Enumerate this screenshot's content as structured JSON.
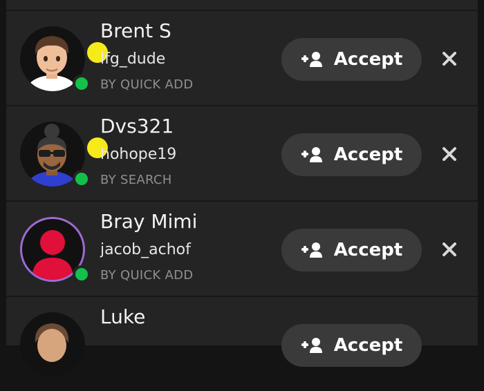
{
  "requests": [
    {
      "name": "Brent S",
      "username": "lfg_dude",
      "source": "BY QUICK ADD",
      "accept_label": "Accept",
      "avatar_icon": "bitmoji-avatar",
      "story_ring_color": "#f7ea1a",
      "online_color": "#13c14a"
    },
    {
      "name": "Dvs321",
      "username": "hohope19",
      "source": "BY SEARCH",
      "accept_label": "Accept",
      "avatar_icon": "bitmoji-avatar",
      "story_ring_color": "#f7ea1a",
      "online_color": "#13c14a"
    },
    {
      "name": "Bray Mimi",
      "username": "jacob_achof",
      "source": "BY QUICK ADD",
      "accept_label": "Accept",
      "avatar_icon": "default-silhouette-avatar",
      "ring_color": "#9b6bd3",
      "online_color": "#13c14a"
    },
    {
      "name": "Luke",
      "username": "",
      "source": "",
      "accept_label": "Accept",
      "avatar_icon": "bitmoji-avatar"
    }
  ]
}
